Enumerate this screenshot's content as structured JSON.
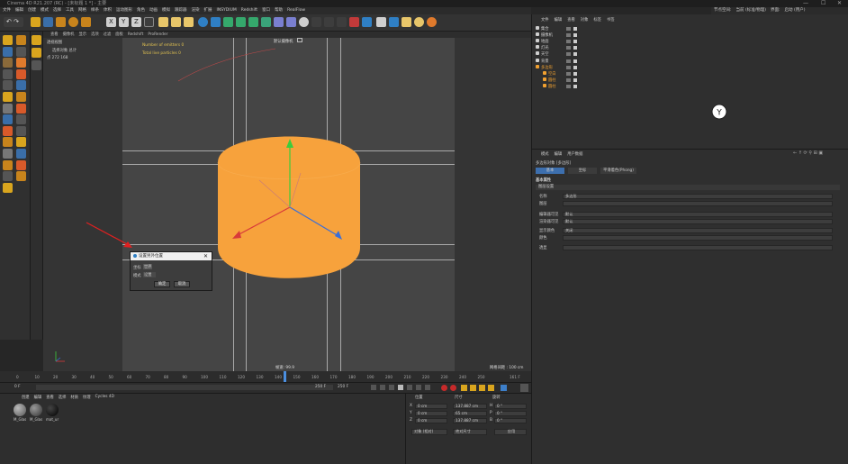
{
  "window": {
    "title": "Cinema 4D R21.207 (RC) - [未标题 1 *] - 主要",
    "controls": [
      "—",
      "☐",
      "✕"
    ]
  },
  "menubar": {
    "left_items": [
      "文件",
      "编辑",
      "创建",
      "模式",
      "选择",
      "工具",
      "网格",
      "样条",
      "体积",
      "运动图形",
      "角色",
      "动画",
      "模拟",
      "跟踪器",
      "渲染",
      "扩展",
      "INSYDIUM",
      "Redshift",
      "窗口",
      "帮助",
      "RealFlow"
    ],
    "right_items": [
      "节点空间:",
      "当前 (标准/物理)",
      "界面:",
      "启动 (用户)"
    ]
  },
  "viewport": {
    "menu": [
      "查看",
      "摄像机",
      "显示",
      "选项",
      "过滤",
      "面板",
      "Redshift",
      "ProRender"
    ],
    "info_title": "透视视图",
    "info_lines": [
      "选择对象  总计",
      "点  272 168"
    ],
    "hud_lines": [
      "Number of emitters 0",
      "Total live particles 0"
    ],
    "camera_label": "默认摄像机",
    "camera_icon": "camera-icon",
    "speed": "帧速: 99.9",
    "grid_spacing": "网格间距 : 100 cm",
    "accent_color": "#f7a23c"
  },
  "dialog": {
    "title": "设置另外位置",
    "field1_label": "坐标",
    "field1_value": "世界",
    "field2_label": "模式",
    "field2_value": "设置",
    "ok_label": "确定",
    "cancel_label": "取消",
    "close_icon": "close-icon"
  },
  "timeline": {
    "ticks": [
      "0",
      "10",
      "20",
      "30",
      "40",
      "50",
      "60",
      "70",
      "80",
      "90",
      "100",
      "110",
      "120",
      "130",
      "140",
      "150",
      "160",
      "170",
      "180",
      "190",
      "200",
      "210",
      "220",
      "230",
      "240",
      "250"
    ],
    "end_label": "161 F",
    "start_frame": "0 F",
    "current_frame": "0 F",
    "end_frame": "250 F",
    "max_frame": "250 F"
  },
  "materials": {
    "menu": [
      "创建",
      "编辑",
      "查看",
      "选择",
      "材质",
      "纹理",
      "Cycles 4D"
    ],
    "items": [
      {
        "name": "M_Glas",
        "color": "#6f6f6f"
      },
      {
        "name": "M_Glas",
        "color": "#4b4b4b"
      },
      {
        "name": "mat_ur",
        "color": "#111111"
      }
    ]
  },
  "coordinates": {
    "headers": [
      "位置",
      "尺寸",
      "旋转"
    ],
    "rows": [
      {
        "axis": "X",
        "pos": "0 cm",
        "size": "137.887 cm",
        "rot_label": "H",
        "rot": "0 °"
      },
      {
        "axis": "Y",
        "pos": "0 cm",
        "size": "65 cm",
        "rot_label": "P",
        "rot": "0 °"
      },
      {
        "axis": "Z",
        "pos": "0 cm",
        "size": "137.887 cm",
        "rot_label": "B",
        "rot": "0 °"
      }
    ],
    "mode_select": "对象 (相对)",
    "size_select": "绝对尺寸",
    "apply_label": "应用"
  },
  "object_manager": {
    "menu": [
      "文件",
      "编辑",
      "查看",
      "对象",
      "标签",
      "书签"
    ],
    "objects": [
      {
        "name": "集合",
        "indent": 0,
        "color": "#cfcfcf"
      },
      {
        "name": "摄像机",
        "indent": 0,
        "color": "#cfcfcf"
      },
      {
        "name": "地面",
        "indent": 0,
        "color": "#cfcfcf"
      },
      {
        "name": "灯光",
        "indent": 0,
        "color": "#cfcfcf"
      },
      {
        "name": "天空",
        "indent": 0,
        "color": "#cfcfcf"
      },
      {
        "name": "背景",
        "indent": 0,
        "color": "#cfcfcf"
      },
      {
        "name": "多边形",
        "indent": 0,
        "color": "#f0a030"
      },
      {
        "name": "空白",
        "indent": 1,
        "color": "#f0a030"
      },
      {
        "name": "圆柱",
        "indent": 1,
        "color": "#f0a030"
      },
      {
        "name": "圆柱",
        "indent": 1,
        "color": "#f0a030"
      }
    ]
  },
  "attribute_manager": {
    "menu": [
      "模式",
      "编辑",
      "用户数据"
    ],
    "object_title": "多边形对象 [多边形]",
    "tabs": [
      "基本",
      "坐标",
      "平滑着色(Phong)"
    ],
    "section": "基本属性",
    "subsection": "图层设置",
    "fields": [
      {
        "label": "名称",
        "value": "多边形"
      },
      {
        "label": "图层",
        "value": ""
      },
      {
        "label": "编辑器可见",
        "value": "默认"
      },
      {
        "label": "渲染器可见",
        "value": "默认"
      },
      {
        "label": "显示颜色",
        "value": "关闭"
      },
      {
        "label": "颜色",
        "value": ""
      },
      {
        "label": "透显",
        "value": ""
      }
    ]
  }
}
